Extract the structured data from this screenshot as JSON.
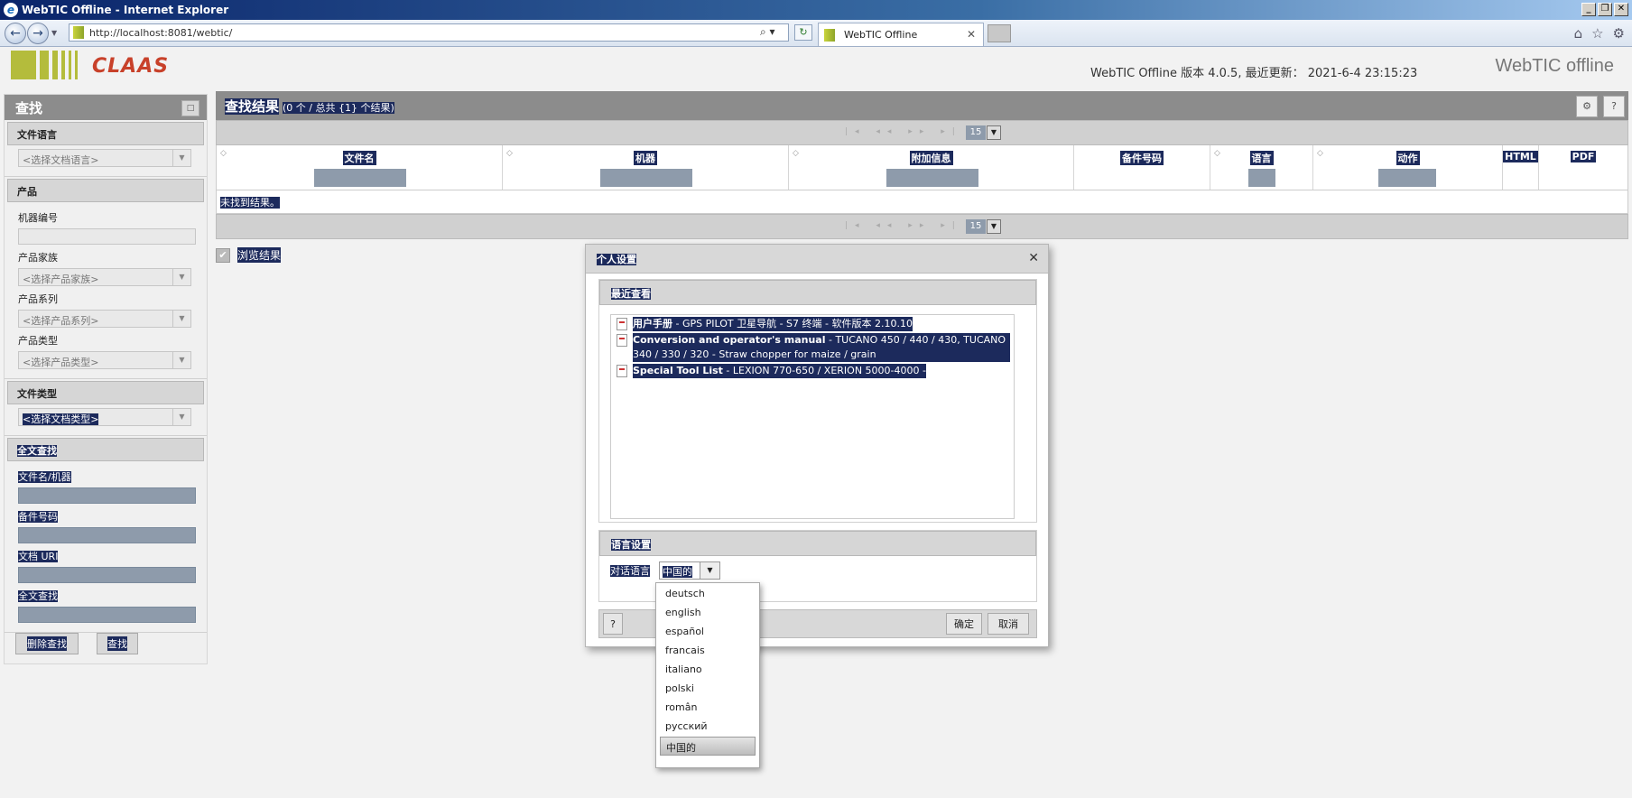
{
  "window": {
    "title": "WebTIC Offline - Internet Explorer",
    "url": "http://localhost:8081/webtic/",
    "tab_title": "WebTIC Offline"
  },
  "header": {
    "logo_text": "CLAAS",
    "version_info": "WebTIC Offline 版本 4.0.5, 最近更新： 2021-6-4 23:15:23",
    "brand": "WebTIC offline"
  },
  "sidebar": {
    "title": "查找",
    "doc_language": {
      "title": "文件语言",
      "placeholder": "<选择文档语言>"
    },
    "product": {
      "title": "产品",
      "machine_no_label": "机器编号",
      "family_label": "产品家族",
      "family_placeholder": "<选择产品家族>",
      "series_label": "产品系列",
      "series_placeholder": "<选择产品系列>",
      "type_label": "产品类型",
      "type_placeholder": "<选择产品类型>"
    },
    "doc_type": {
      "title": "文件类型",
      "placeholder": "<选择文档类型>"
    },
    "fulltext": {
      "title": "全文查找",
      "filename_label": "文件名/机器",
      "partno_label": "备件号码",
      "uri_label": "文档 URI",
      "fulltext_label": "全文查找"
    },
    "delete_button": "删除查找",
    "search_button": "查找"
  },
  "results": {
    "title": "查找结果",
    "count": "(0 个 / 总共 {1} 个结果)",
    "page_size": "15",
    "columns": [
      "文件名",
      "机器",
      "附加信息",
      "备件号码",
      "语言",
      "动作",
      "HTML",
      "PDF"
    ],
    "no_result": "未找到结果。",
    "browse_label": "浏览结果"
  },
  "dialog": {
    "title": "个人设置",
    "recent_title": "最近查看",
    "recent_items": [
      {
        "bold": "用户手册",
        "rest": " - GPS PILOT 卫星导航 - S7 终端 - 软件版本 2.10.10"
      },
      {
        "bold": "Conversion and operator's manual",
        "rest": " - TUCANO 450 / 440 / 430, TUCANO 340 / 330 / 320 - Straw chopper for maize / grain"
      },
      {
        "bold": "Special Tool List",
        "rest": " - LEXION 770-650 / XERION 5000-4000 -"
      }
    ],
    "lang_title": "语言设置",
    "lang_label": "对话语言",
    "lang_value": "中国的",
    "help_button": "?",
    "ok_button": "确定",
    "cancel_button": "取消"
  },
  "language_options": [
    "deutsch",
    "english",
    "español",
    "francais",
    "italiano",
    "polski",
    "român",
    "русский",
    "中国的"
  ]
}
